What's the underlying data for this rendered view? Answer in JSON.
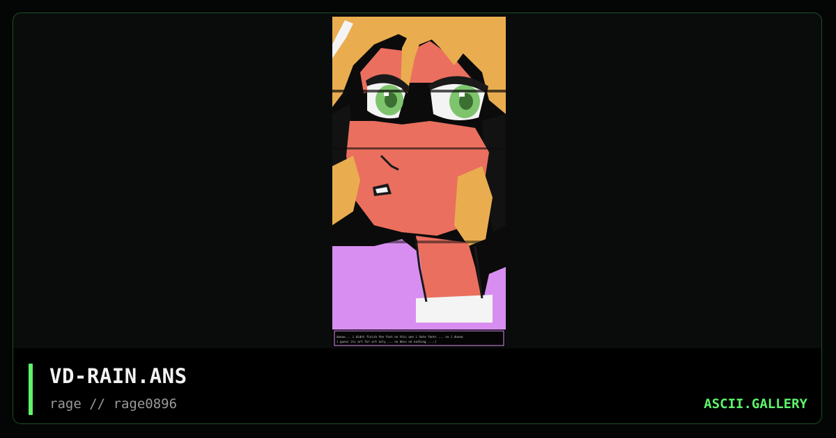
{
  "artwork": {
    "caption_line1": "doooo... i didnt finish the font on this one i hate fonts ... so i dunno",
    "caption_line2": "i guess its art for art only ... no bbss no nothing ...:)",
    "palette": {
      "hair": "#e9ad4f",
      "skin": "#ea6f5e",
      "eye_iris": "#7ec46d",
      "shirt": "#d88ef0",
      "outline": "#1a1a1a",
      "white": "#f4f4f4"
    }
  },
  "footer": {
    "title": "VD-RAIN.ANS",
    "subtitle": "rage // rage0896",
    "site": "ASCII.GALLERY"
  },
  "colors": {
    "accent": "#5ef46a",
    "background": "#0a0b0b",
    "border": "#1f4f24"
  }
}
